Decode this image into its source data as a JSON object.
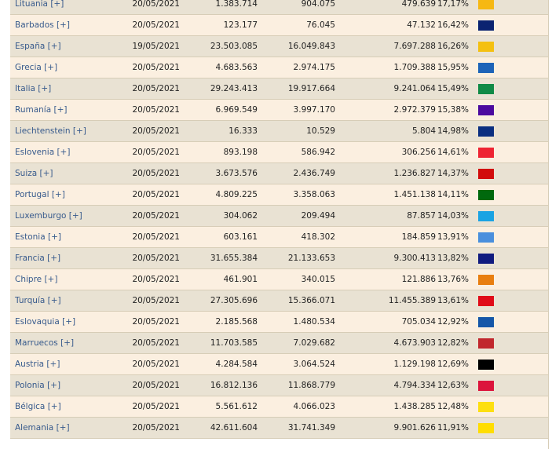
{
  "rows": [
    {
      "country": "Lituania [+]",
      "date": "20/05/2021",
      "total": "1.383.714",
      "first": "904.075",
      "full": "479.639",
      "pct": "17,17%",
      "color": "#f6b813"
    },
    {
      "country": "Barbados [+]",
      "date": "20/05/2021",
      "total": "123.177",
      "first": "76.045",
      "full": "47.132",
      "pct": "16,42%",
      "color": "#0b2371"
    },
    {
      "country": "España [+]",
      "date": "19/05/2021",
      "total": "23.503.085",
      "first": "16.049.843",
      "full": "7.697.288",
      "pct": "16,26%",
      "color": "#f4c010"
    },
    {
      "country": "Grecia [+]",
      "date": "20/05/2021",
      "total": "4.683.563",
      "first": "2.974.175",
      "full": "1.709.388",
      "pct": "15,95%",
      "color": "#1d63b8"
    },
    {
      "country": "Italia [+]",
      "date": "20/05/2021",
      "total": "29.243.413",
      "first": "19.917.664",
      "full": "9.241.064",
      "pct": "15,49%",
      "color": "#0f8a46"
    },
    {
      "country": "Rumanía [+]",
      "date": "20/05/2021",
      "total": "6.969.549",
      "first": "3.997.170",
      "full": "2.972.379",
      "pct": "15,38%",
      "color": "#4b0a9f"
    },
    {
      "country": "Liechtenstein [+]",
      "date": "20/05/2021",
      "total": "16.333",
      "first": "10.529",
      "full": "5.804",
      "pct": "14,98%",
      "color": "#0a2e80"
    },
    {
      "country": "Eslovenia [+]",
      "date": "20/05/2021",
      "total": "893.198",
      "first": "586.942",
      "full": "306.256",
      "pct": "14,61%",
      "color": "#ee2433"
    },
    {
      "country": "Suiza [+]",
      "date": "20/05/2021",
      "total": "3.673.576",
      "first": "2.436.749",
      "full": "1.236.827",
      "pct": "14,37%",
      "color": "#d20c0c"
    },
    {
      "country": "Portugal [+]",
      "date": "20/05/2021",
      "total": "4.809.225",
      "first": "3.358.063",
      "full": "1.451.138",
      "pct": "14,11%",
      "color": "#00690d"
    },
    {
      "country": "Luxemburgo [+]",
      "date": "20/05/2021",
      "total": "304.062",
      "first": "209.494",
      "full": "87.857",
      "pct": "14,03%",
      "color": "#1aa3e3"
    },
    {
      "country": "Estonia [+]",
      "date": "20/05/2021",
      "total": "603.161",
      "first": "418.302",
      "full": "184.859",
      "pct": "13,91%",
      "color": "#4a8fdd"
    },
    {
      "country": "Francia [+]",
      "date": "20/05/2021",
      "total": "31.655.384",
      "first": "21.133.653",
      "full": "9.300.413",
      "pct": "13,82%",
      "color": "#101b7f"
    },
    {
      "country": "Chipre [+]",
      "date": "20/05/2021",
      "total": "461.901",
      "first": "340.015",
      "full": "121.886",
      "pct": "13,76%",
      "color": "#e87e10"
    },
    {
      "country": "Turquía [+]",
      "date": "20/05/2021",
      "total": "27.305.696",
      "first": "15.366.071",
      "full": "11.455.389",
      "pct": "13,61%",
      "color": "#e00b18"
    },
    {
      "country": "Eslovaquia [+]",
      "date": "20/05/2021",
      "total": "2.185.568",
      "first": "1.480.534",
      "full": "705.034",
      "pct": "12,92%",
      "color": "#1556a8"
    },
    {
      "country": "Marruecos [+]",
      "date": "20/05/2021",
      "total": "11.703.585",
      "first": "7.029.682",
      "full": "4.673.903",
      "pct": "12,82%",
      "color": "#c1272d"
    },
    {
      "country": "Austria [+]",
      "date": "20/05/2021",
      "total": "4.284.584",
      "first": "3.064.524",
      "full": "1.129.198",
      "pct": "12,69%",
      "color": "#000000"
    },
    {
      "country": "Polonia [+]",
      "date": "20/05/2021",
      "total": "16.812.136",
      "first": "11.868.779",
      "full": "4.794.334",
      "pct": "12,63%",
      "color": "#dc143c"
    },
    {
      "country": "Bélgica [+]",
      "date": "20/05/2021",
      "total": "5.561.612",
      "first": "4.066.023",
      "full": "1.438.285",
      "pct": "12,48%",
      "color": "#fddf10"
    },
    {
      "country": "Alemania [+]",
      "date": "20/05/2021",
      "total": "42.611.604",
      "first": "31.741.349",
      "full": "9.901.626",
      "pct": "11,91%",
      "color": "#ffdd00"
    }
  ]
}
